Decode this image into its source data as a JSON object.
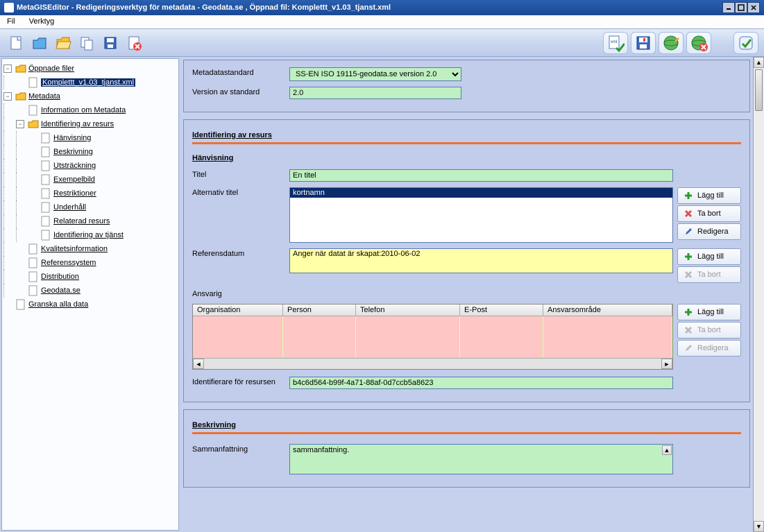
{
  "title": "MetaGISEditor - Redigeringsverktyg för metadata - Geodata.se , Öppnad fil: Komplettt_v1.03_tjanst.xml",
  "menu": {
    "file": "Fil",
    "tools": "Verktyg"
  },
  "tree": {
    "opened_files": "Öppnade filer",
    "file1": "Komplettt_v1.03_tjanst.xml",
    "metadata": "Metadata",
    "info_metadata": "Information om Metadata",
    "ident_resurs": "Identifiering av resurs",
    "hanvisning": "Hänvisning",
    "beskrivning": "Beskrivning",
    "utstrackning": "Utsträckning",
    "exempelbild": "Exempelbild",
    "restriktioner": "Restriktioner",
    "underhall": "Underhåll",
    "relaterad_resurs": "Relaterad resurs",
    "ident_tjanst": "Identifiering av tjänst",
    "kvalitet": "Kvalitetsinformation",
    "referenssystem": "Referenssystem",
    "distribution": "Distribution",
    "geodata": "Geodata.se",
    "granska": "Granska alla data"
  },
  "form": {
    "metadatastandard_label": "Metadatastandard",
    "metadatastandard_value": "SS-EN ISO 19115-geodata.se version 2.0",
    "version_label": "Version av standard",
    "version_value": "2.0",
    "section_ident": "Identifiering av resurs",
    "hanvisning_label": "Hänvisning",
    "titel_label": "Titel",
    "titel_value": "En titel",
    "alt_titel_label": "Alternativ titel",
    "alt_titel_item": "kortnamn",
    "refdatum_label": "Referensdatum",
    "refdatum_value": "Anger när datat är skapat:2010-06-02",
    "ansvarig_label": "Ansvarig",
    "cols": {
      "org": "Organisation",
      "person": "Person",
      "tel": "Telefon",
      "epost": "E-Post",
      "omrade": "Ansvarsområde"
    },
    "ident_resurs_label": "Identifierare för resursen",
    "ident_resurs_value": "b4c6d564-b99f-4a71-88af-0d7ccb5a8623",
    "beskrivning_section": "Beskrivning",
    "sammanfattning_label": "Sammanfattning",
    "sammanfattning_value": "sammanfattning."
  },
  "buttons": {
    "lagg_till": "Lägg till",
    "ta_bort": "Ta bort",
    "redigera": "Redigera"
  }
}
